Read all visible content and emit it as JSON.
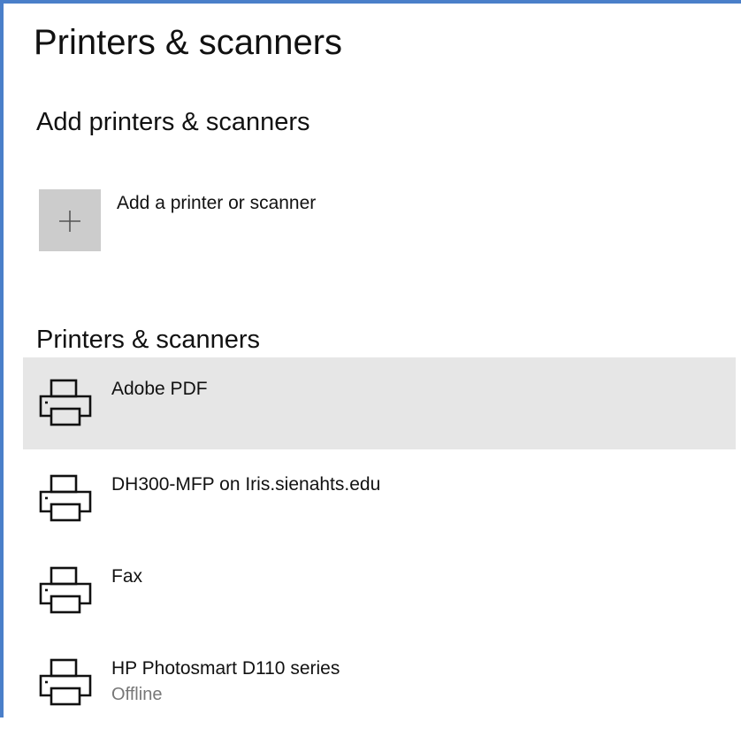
{
  "page": {
    "title": "Printers & scanners"
  },
  "add_section": {
    "heading": "Add printers & scanners",
    "add_label": "Add a printer or scanner",
    "add_icon": "plus-icon"
  },
  "devices_section": {
    "heading": "Printers & scanners",
    "items": [
      {
        "name": "Adobe PDF",
        "status": "",
        "icon": "printer-icon",
        "selected": true
      },
      {
        "name": "DH300-MFP on Iris.sienahts.edu",
        "status": "",
        "icon": "printer-icon",
        "selected": false
      },
      {
        "name": "Fax",
        "status": "",
        "icon": "printer-icon",
        "selected": false
      },
      {
        "name": "HP Photosmart D110 series",
        "status": "Offline",
        "icon": "printer-icon",
        "selected": false
      }
    ]
  },
  "colors": {
    "window_border": "#4a7fc9",
    "selected_row": "#e6e6e6",
    "add_tile": "#cccccc",
    "status_text": "#777777"
  }
}
